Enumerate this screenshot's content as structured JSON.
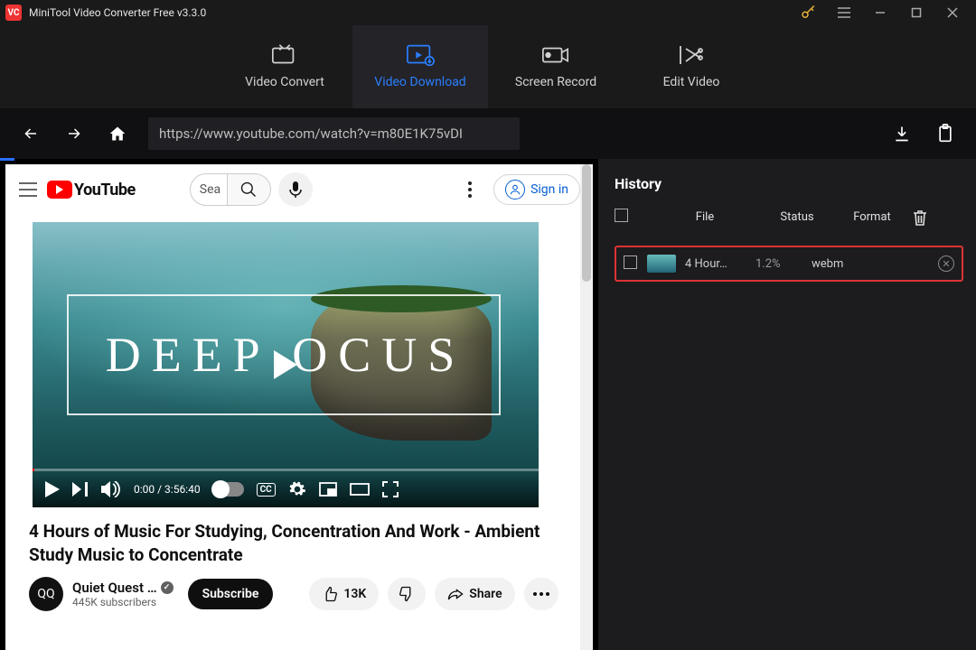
{
  "app": {
    "title": "MiniTool Video Converter Free v3.3.0",
    "logo_text": "VC"
  },
  "tabs": {
    "video_convert": "Video Convert",
    "video_download": "Video Download",
    "screen_record": "Screen Record",
    "edit_video": "Edit Video"
  },
  "url": "https://www.youtube.com/watch?v=m80E1K75vDI",
  "youtube": {
    "brand": "YouTube",
    "search_placeholder": "Sea",
    "signin": "Sign in",
    "video_overlay": "DEEP   OCUS",
    "time": "0:00 / 3:56:40",
    "cc": "CC",
    "title": "4 Hours of Music For Studying, Concentration And Work - Ambient Study Music to Concentrate",
    "channel": "Quiet Quest …",
    "subscribers": "445K subscribers",
    "subscribe": "Subscribe",
    "likes": "13K",
    "share": "Share",
    "avatar_letters": "QQ",
    "verified_glyph": "✓"
  },
  "history": {
    "title": "History",
    "columns": {
      "file": "File",
      "status": "Status",
      "format": "Format"
    },
    "row": {
      "file": "4 Hour…",
      "status": "1.2%",
      "format": "webm"
    }
  }
}
